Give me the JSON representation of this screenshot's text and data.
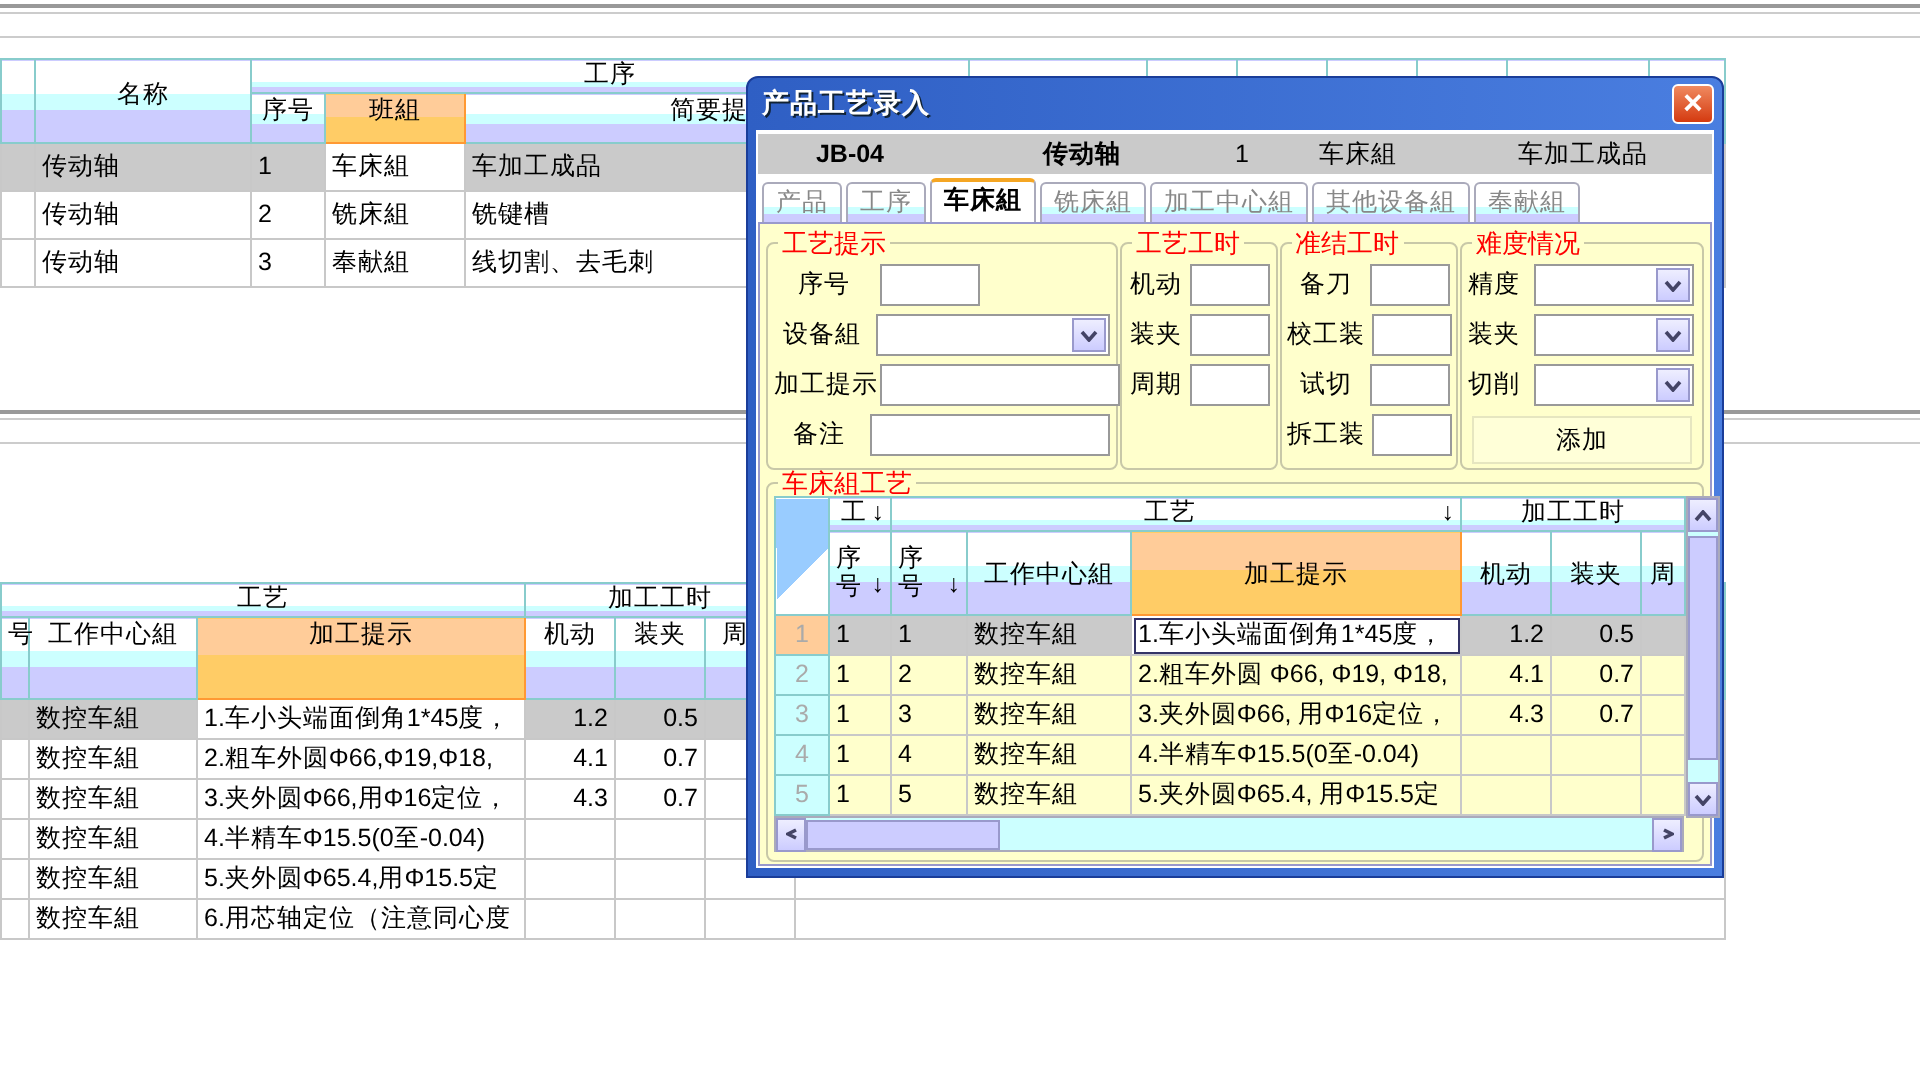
{
  "top_table": {
    "header": [
      {
        "kind": "column",
        "label": "名称",
        "selected": false
      },
      {
        "kind": "group",
        "label": "工序",
        "columns": [
          {
            "label": "序号",
            "selected": false
          },
          {
            "label": "班組",
            "selected": true
          },
          {
            "label": "简要提",
            "selected": false
          }
        ]
      },
      {
        "kind": "group"
      }
    ],
    "rows": [
      {
        "selected": true,
        "cells": [
          "传动轴",
          "1",
          "车床組",
          "车加工成品"
        ]
      },
      {
        "selected": false,
        "cells": [
          "传动轴",
          "2",
          "铣床組",
          "铣键槽"
        ]
      },
      {
        "selected": false,
        "cells": [
          "传动轴",
          "3",
          "奉献組",
          "线切割、去毛刺"
        ]
      }
    ]
  },
  "bottom_table": {
    "header": [
      {
        "kind": "group",
        "label": "工艺",
        "columns": [
          {
            "label": "号",
            "selected": false
          },
          {
            "label": "工作中心組",
            "selected": false
          },
          {
            "label": "加工提示",
            "selected": true
          }
        ]
      },
      {
        "kind": "group",
        "label": "加工工时",
        "columns": [
          {
            "label": "机动",
            "selected": false
          },
          {
            "label": "装夹",
            "selected": false
          },
          {
            "label": "周",
            "selected": false
          }
        ]
      }
    ],
    "rows": [
      {
        "selected": true,
        "cells": [
          "数控车組",
          "1.车小头端面倒角1*45度，",
          "1.2",
          "0.5"
        ]
      },
      {
        "selected": false,
        "cells": [
          "数控车組",
          "2.粗车外圆Φ66,Φ19,Φ18,",
          "4.1",
          "0.7"
        ]
      },
      {
        "selected": false,
        "cells": [
          "数控车組",
          "3.夹外圆Φ66,用Φ16定位，",
          "4.3",
          "0.7"
        ]
      },
      {
        "selected": false,
        "cells": [
          "数控车組",
          "4.半精车Φ15.5(0至-0.04)"
        ]
      },
      {
        "selected": false,
        "cells": [
          "数控车組",
          "5.夹外圆Φ65.4,用Φ15.5定"
        ]
      },
      {
        "selected": false,
        "cells": [
          "数控车組",
          "6.用芯轴定位（注意同心度"
        ]
      }
    ]
  },
  "dialog": {
    "title": "产品工艺录入",
    "close": "×",
    "info": [
      {
        "text": "JB-04",
        "bold": true
      },
      {
        "text": "传动轴",
        "bold": true
      },
      {
        "text": "1",
        "bold": false
      },
      {
        "text": "车床組",
        "bold": false
      },
      {
        "text": "车加工成品",
        "bold": false
      }
    ],
    "tabs": [
      {
        "label": "产品",
        "selected": false
      },
      {
        "label": "工序",
        "selected": false
      },
      {
        "label": "车床組",
        "selected": true
      },
      {
        "label": "铣床組",
        "selected": false
      },
      {
        "label": "加工中心組",
        "selected": false
      },
      {
        "label": "其他设备組",
        "selected": false
      },
      {
        "label": "奉献組",
        "selected": false
      }
    ],
    "groups": [
      {
        "legend": "工艺提示",
        "fields": [
          {
            "label": "序号",
            "kind": "short"
          },
          {
            "label": "设备組",
            "kind": "select"
          },
          {
            "label": "加工提示",
            "kind": "text"
          },
          {
            "label": "备注",
            "kind": "text"
          }
        ]
      },
      {
        "legend": "工艺工时",
        "fields": [
          {
            "label": "机动",
            "kind": "text"
          },
          {
            "label": "装夹",
            "kind": "text"
          },
          {
            "label": "周期",
            "kind": "text"
          }
        ]
      },
      {
        "legend": "准结工时",
        "fields": [
          {
            "label": "备刀",
            "kind": "text"
          },
          {
            "label": "校工装",
            "kind": "text"
          },
          {
            "label": "试切",
            "kind": "text"
          },
          {
            "label": "拆工装",
            "kind": "text"
          }
        ]
      },
      {
        "legend": "难度情况",
        "fields": [
          {
            "label": "精度",
            "kind": "select"
          },
          {
            "label": "装夹",
            "kind": "select"
          },
          {
            "label": "切削",
            "kind": "select"
          }
        ],
        "button": "添加"
      }
    ],
    "grid": {
      "legend": "车床組工艺",
      "header": [
        {
          "label": "工",
          "arrow": "↓",
          "columns": [
            {
              "label": "序号",
              "arrow": "↓",
              "selected": false
            }
          ]
        },
        {
          "label": "工艺",
          "arrow": "↓",
          "columns": [
            {
              "label": "序号",
              "arrow": "↓",
              "selected": false
            },
            {
              "label": "工作中心組",
              "selected": false
            },
            {
              "label": "加工提示",
              "selected": true
            }
          ]
        },
        {
          "label": "加工工时",
          "columns": [
            {
              "label": "机动",
              "selected": false
            },
            {
              "label": "装夹",
              "selected": false
            },
            {
              "label": "周",
              "selected": false
            }
          ]
        }
      ],
      "rows": [
        {
          "number": "1",
          "selected": true,
          "cells": [
            "1",
            "1",
            "数控车組",
            "1.车小头端面倒角1*45度，",
            "1.2",
            "0.5"
          ]
        },
        {
          "number": "2",
          "selected": false,
          "cells": [
            "1",
            "2",
            "数控车組",
            "2.粗车外圆 Φ66, Φ19, Φ18,",
            "4.1",
            "0.7"
          ]
        },
        {
          "number": "3",
          "selected": false,
          "cells": [
            "1",
            "3",
            "数控车組",
            "3.夹外圆Φ66, 用Φ16定位，",
            "4.3",
            "0.7"
          ]
        },
        {
          "number": "4",
          "selected": false,
          "cells": [
            "1",
            "4",
            "数控车組",
            "4.半精车Φ15.5(0至-0.04)"
          ]
        },
        {
          "number": "5",
          "selected": false,
          "cells": [
            "1",
            "5",
            "数控车組",
            "5.夹外圆Φ65.4, 用Φ15.5定"
          ]
        }
      ]
    }
  }
}
